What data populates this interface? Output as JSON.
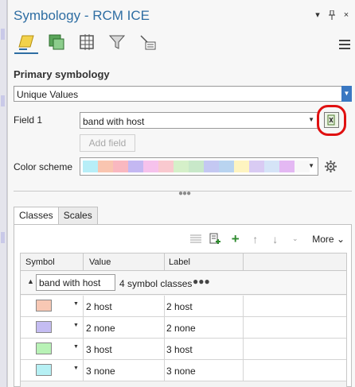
{
  "window": {
    "title": "Symbology - RCM ICE",
    "close_glyph": "×",
    "pin_glyph": "📌",
    "minimize_glyph": "▾"
  },
  "toolbar_tabs": [
    {
      "icon": "primary-symbology-icon"
    },
    {
      "icon": "vary-symbology-icon"
    },
    {
      "icon": "symbol-layers-icon"
    },
    {
      "icon": "filter-icon"
    },
    {
      "icon": "label-classes-icon"
    }
  ],
  "primary": {
    "heading": "Primary symbology",
    "renderer": "Unique Values",
    "field1_label": "Field 1",
    "field1_value": "band with host",
    "add_field_label": "Add field",
    "color_scheme_label": "Color scheme",
    "color_scheme_colors": [
      "#b7eef7",
      "#f9c5b0",
      "#f9b8c0",
      "#c4b8f2",
      "#f6c2ec",
      "#f9c9cf",
      "#d5f0c9",
      "#c8e8c9",
      "#c4c8f2",
      "#b9d4f0",
      "#fef4c0",
      "#d9cbf3",
      "#d5e4f7",
      "#e4b8f3",
      "#f7f7f7"
    ]
  },
  "lower": {
    "tabs": [
      "Classes",
      "Scales"
    ],
    "more_label": "More",
    "columns": [
      "Symbol",
      "Value",
      "Label"
    ],
    "group": {
      "field": "band with host",
      "count": "4 symbol classes",
      "dots": "●●●"
    },
    "rows": [
      {
        "color": "#f8c8b4",
        "value": "2 host",
        "label": "2 host"
      },
      {
        "color": "#c4bcf2",
        "value": "2 none",
        "label": "2 none"
      },
      {
        "color": "#b8f2b6",
        "value": "3 host",
        "label": "3 host"
      },
      {
        "color": "#b6f0f4",
        "value": "3 none",
        "label": "3 none"
      }
    ]
  },
  "colors": {
    "accent": "#2f6ea3",
    "highlight": "#e01010"
  }
}
